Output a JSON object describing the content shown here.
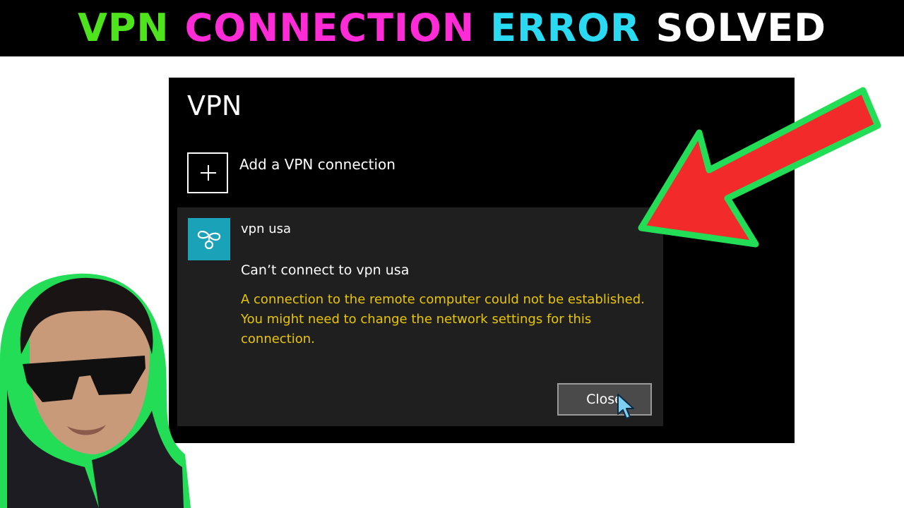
{
  "banner": {
    "words": [
      {
        "text": "VPN",
        "color": "#4ee31c"
      },
      {
        "text": "CONNECTION",
        "color": "#ff2bd6"
      },
      {
        "text": "ERROR",
        "color": "#2ad9f2"
      },
      {
        "text": "SOLVED",
        "color": "#ffffff"
      }
    ]
  },
  "panel": {
    "title": "VPN",
    "add_label": "Add a VPN connection",
    "add_icon": "plus-icon"
  },
  "connection": {
    "icon": "vpn-connection-icon",
    "name": "vpn usa",
    "status": "Can’t connect to vpn usa",
    "error": "A connection to the remote computer could not be established.  You might need to change the network settings for this connection.",
    "close_label": "Close",
    "icon_color": "#1aa3b8",
    "error_color": "#e8c600"
  },
  "overlay": {
    "arrow_color": "#f22a2a",
    "outline_color": "#22dd55"
  }
}
